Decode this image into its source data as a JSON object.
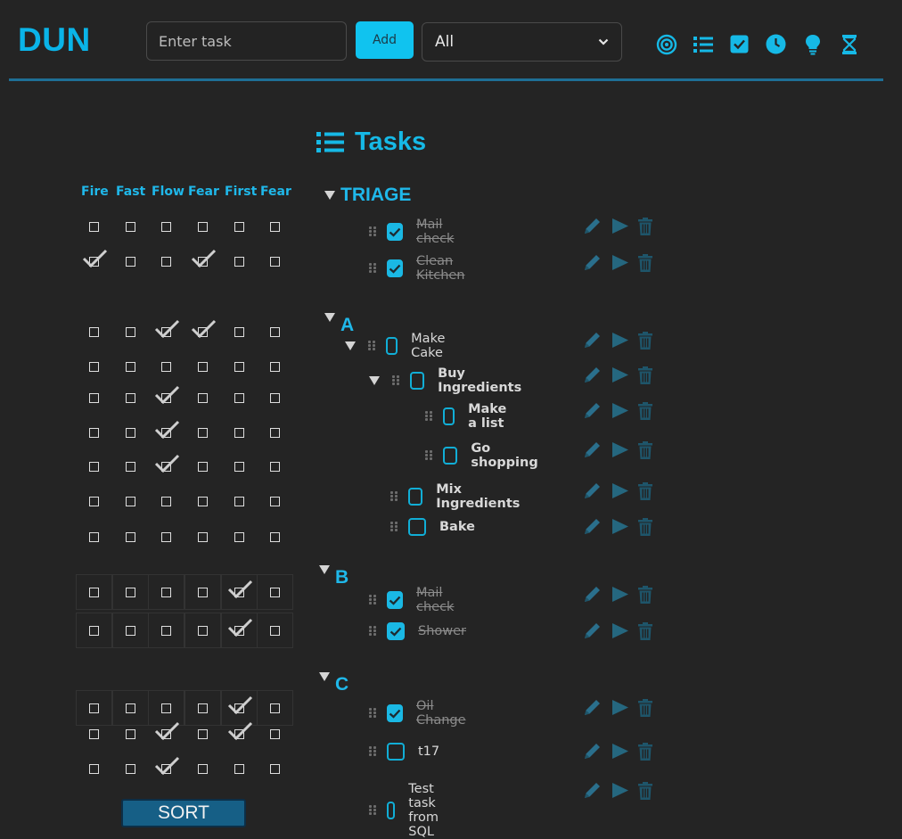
{
  "header": {
    "logo": "DUN",
    "task_placeholder": "Enter task",
    "add_label": "Add",
    "filter_value": "All",
    "icons": [
      "target-icon",
      "list-icon",
      "checkbox-icon",
      "clock-icon",
      "lightbulb-icon",
      "hourglass-icon"
    ]
  },
  "tasks_title": "Tasks",
  "matrix": {
    "columns": [
      "Fire",
      "Fast",
      "Flow",
      "Fear",
      "First",
      "Fear"
    ],
    "sort_label": "SORT"
  },
  "groups": [
    {
      "label": "TRIAGE",
      "tasks": [
        {
          "label": "Mail check",
          "done": true
        },
        {
          "label": "Clean Kitchen",
          "done": true
        }
      ]
    },
    {
      "label": "A",
      "tasks": [
        {
          "label": "Make Cake",
          "done": false
        },
        {
          "label": "Buy Ingredients",
          "done": false
        },
        {
          "label": "Make a list",
          "done": false
        },
        {
          "label": "Go shopping",
          "done": false
        },
        {
          "label": "Mix Ingredients",
          "done": false
        },
        {
          "label": "Bake",
          "done": false
        }
      ]
    },
    {
      "label": "B",
      "tasks": [
        {
          "label": "Mail check",
          "done": true
        },
        {
          "label": "Shower",
          "done": true
        }
      ]
    },
    {
      "label": "C",
      "tasks": [
        {
          "label": "Oil Change",
          "done": true
        },
        {
          "label": "t17",
          "done": false
        },
        {
          "label": "Test task from SQL",
          "done": false
        }
      ]
    }
  ],
  "colors": {
    "accent": "#10c3ef",
    "rule": "#1e6f95",
    "sort": "#165f86",
    "background": "#242424"
  }
}
